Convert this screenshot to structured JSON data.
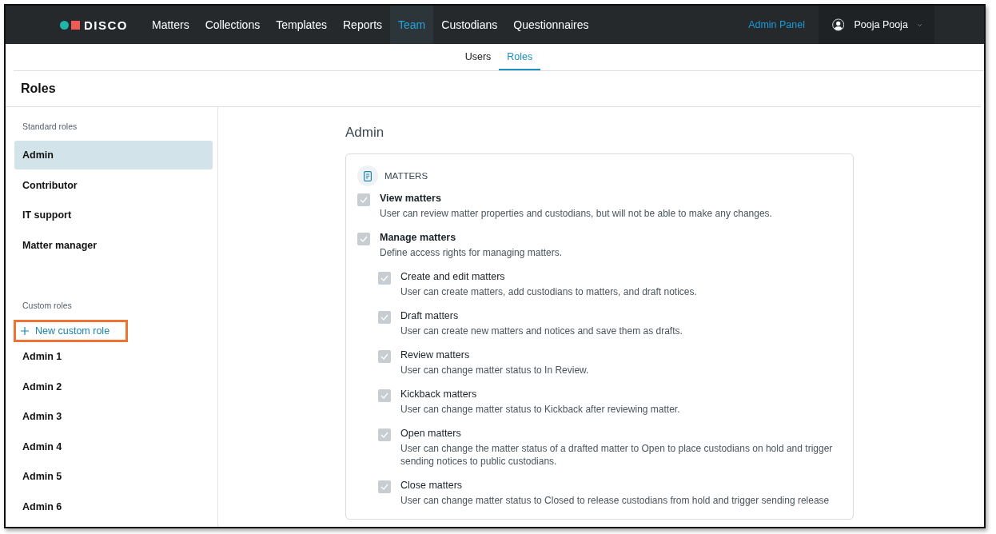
{
  "navbar": {
    "logo": "DISCO",
    "items": [
      {
        "label": "Matters",
        "selected": false
      },
      {
        "label": "Collections",
        "selected": false
      },
      {
        "label": "Templates",
        "selected": false
      },
      {
        "label": "Reports",
        "selected": false
      },
      {
        "label": "Team",
        "selected": true
      },
      {
        "label": "Custodians",
        "selected": false
      },
      {
        "label": "Questionnaires",
        "selected": false
      }
    ],
    "admin_link": "Admin Panel",
    "user": {
      "name": "Pooja Pooja"
    }
  },
  "subtabs": [
    {
      "label": "Users",
      "selected": false
    },
    {
      "label": "Roles",
      "selected": true
    }
  ],
  "page_title": "Roles",
  "sidebar": {
    "sections": [
      {
        "heading": "Standard roles",
        "items": [
          {
            "label": "Admin",
            "selected": true
          },
          {
            "label": "Contributor",
            "selected": false
          },
          {
            "label": "IT support",
            "selected": false
          },
          {
            "label": "Matter manager",
            "selected": false
          }
        ]
      },
      {
        "heading": "Custom roles",
        "new_button": {
          "label": "New custom role",
          "highlighted": true
        },
        "items": [
          {
            "label": "Admin 1",
            "selected": false
          },
          {
            "label": "Admin 2",
            "selected": false
          },
          {
            "label": "Admin 3",
            "selected": false
          },
          {
            "label": "Admin 4",
            "selected": false
          },
          {
            "label": "Admin 5",
            "selected": false
          },
          {
            "label": "Admin 6",
            "selected": false
          }
        ]
      }
    ]
  },
  "role": {
    "title": "Admin",
    "section": {
      "title": "MATTERS",
      "permissions": [
        {
          "name": "View matters",
          "description": "User can review matter properties and custodians, but will not be able to make any changes.",
          "checked": true,
          "disabled": true
        },
        {
          "name": "Manage matters",
          "description": "Define access rights for managing matters.",
          "checked": true,
          "disabled": true,
          "children": [
            {
              "name": "Create and edit matters",
              "description": "User can create matters, add custodians to matters, and draft notices.",
              "checked": true,
              "disabled": true
            },
            {
              "name": "Draft matters",
              "description": "User can create new matters and notices and save them as drafts.",
              "checked": true,
              "disabled": true
            },
            {
              "name": "Review matters",
              "description": "User can change matter status to In Review.",
              "checked": true,
              "disabled": true
            },
            {
              "name": "Kickback matters",
              "description": "User can change matter status to Kickback after reviewing matter.",
              "checked": true,
              "disabled": true
            },
            {
              "name": "Open matters",
              "description": "User can change the matter status of a drafted matter to Open to place custodians on hold and trigger sending notices to public custodians.",
              "checked": true,
              "disabled": true
            },
            {
              "name": "Close matters",
              "description": "User can change matter status to Closed to release custodians from hold and trigger sending release",
              "checked": true,
              "disabled": true
            }
          ]
        }
      ]
    }
  }
}
